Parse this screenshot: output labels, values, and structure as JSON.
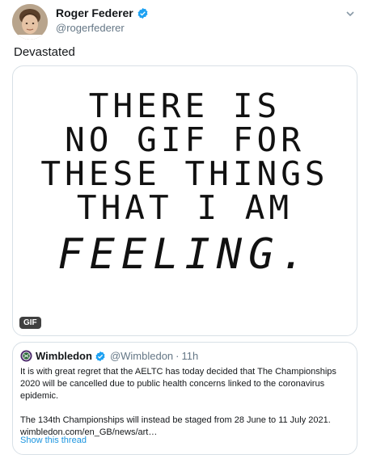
{
  "author": {
    "name": "Roger Federer",
    "handle": "@rogerfederer",
    "verified": true
  },
  "tweet": {
    "text": "Devastated"
  },
  "media": {
    "type": "gif",
    "badge": "GIF",
    "lines": [
      "THERE IS",
      "NO GIF FOR",
      "THESE THINGS",
      "THAT I AM"
    ],
    "emphasis_line": "FEELING."
  },
  "quoted_tweet": {
    "name": "Wimbledon",
    "handle": "@Wimbledon",
    "separator": "·",
    "time": "11h",
    "verified": true,
    "paragraph1": "It is with great regret that the AELTC has today decided that The Championships 2020 will be cancelled due to public health concerns linked to the coronavirus epidemic.",
    "paragraph2_line1": "The 134th Championships will instead be staged from 28 June to 11 July 2021.",
    "paragraph2_line2": "wimbledon.com/en_GB/news/art…",
    "show_thread": "Show this thread"
  },
  "colors": {
    "link_blue": "#1b95e0",
    "verified_blue": "#1da1f2",
    "muted_gray": "#657786",
    "border": "#d8e0e6",
    "wimbledon_purple": "#4b2a6b",
    "wimbledon_green": "#2c6b3a"
  },
  "icons": {
    "verified": "verified-badge-icon",
    "caret": "chevron-down-icon",
    "wimbledon_logo": "wimbledon-logo-icon"
  }
}
